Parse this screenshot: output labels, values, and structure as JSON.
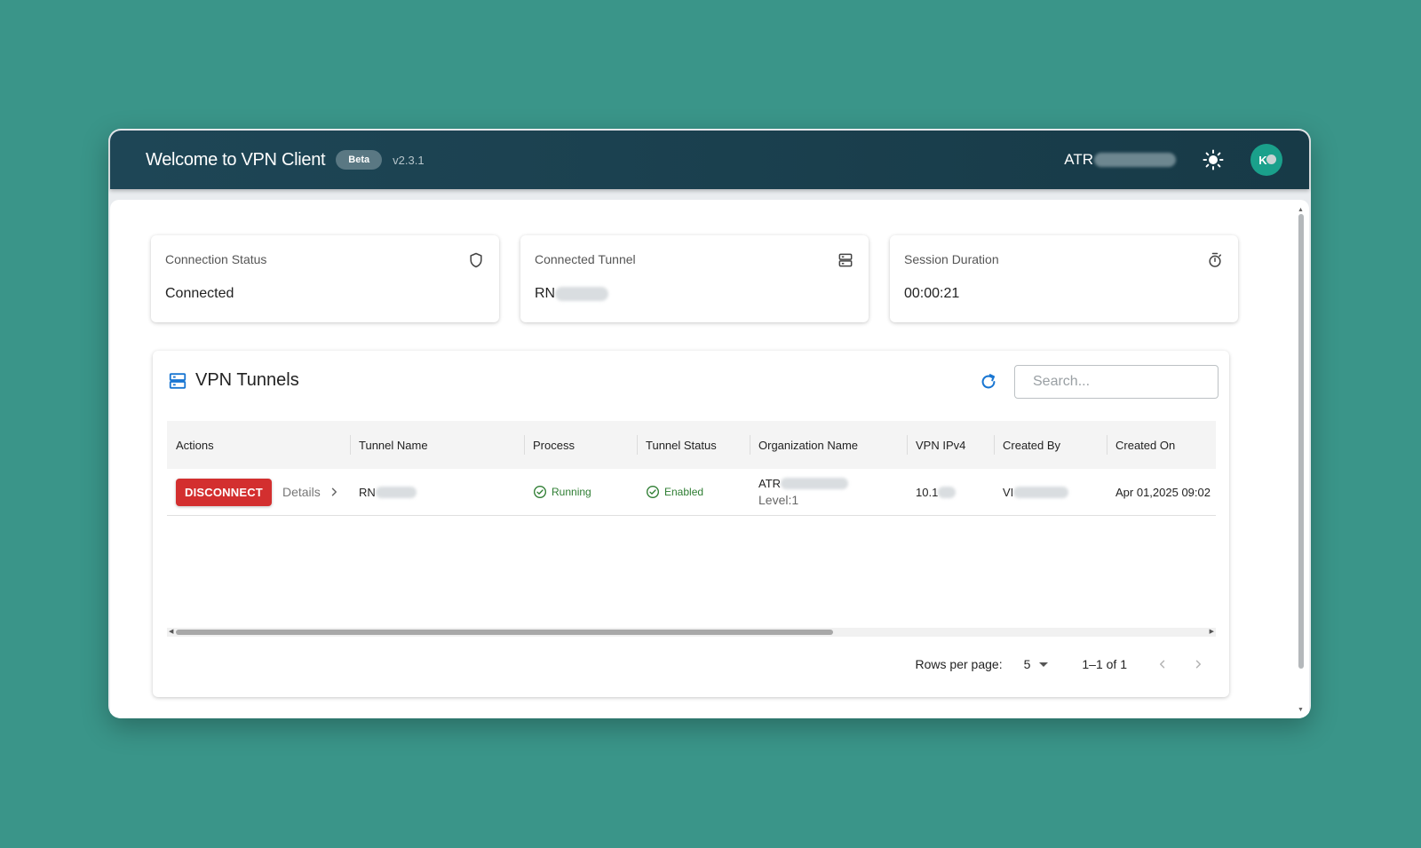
{
  "app": {
    "title": "Welcome to VPN Client",
    "badge": "Beta",
    "version": "v2.3.1",
    "org_prefix": "ATR",
    "avatar_initial": "K"
  },
  "stats": {
    "connection_status": {
      "label": "Connection Status",
      "value": "Connected",
      "icon": "shield-icon"
    },
    "connected_tunnel": {
      "label": "Connected Tunnel",
      "value": "RN",
      "icon": "server-icon"
    },
    "session_duration": {
      "label": "Session Duration",
      "value": "00:00:21",
      "icon": "stopwatch-icon"
    }
  },
  "tunnels": {
    "title": "VPN Tunnels",
    "search_placeholder": "Search...",
    "columns": [
      "Actions",
      "Tunnel Name",
      "Process",
      "Tunnel Status",
      "Organization Name",
      "VPN IPv4",
      "Created By",
      "Created On"
    ],
    "rows": [
      {
        "action_label": "DISCONNECT",
        "details_label": "Details",
        "tunnel_name": "RN",
        "process": "Running",
        "tunnel_status": "Enabled",
        "organization": "ATR",
        "level": "Level:1",
        "ipv4": "10.1",
        "created_by": "VI",
        "created_on": "Apr 01,2025 09:02"
      }
    ],
    "pagination": {
      "rows_per_page_label": "Rows per page:",
      "rows_per_page": "5",
      "range": "1–1 of 1"
    }
  },
  "colors": {
    "background": "#3a9589",
    "appbar": "#1e4656",
    "accent": "#1976d2",
    "danger": "#d32f2f",
    "success": "#2e7d32"
  }
}
